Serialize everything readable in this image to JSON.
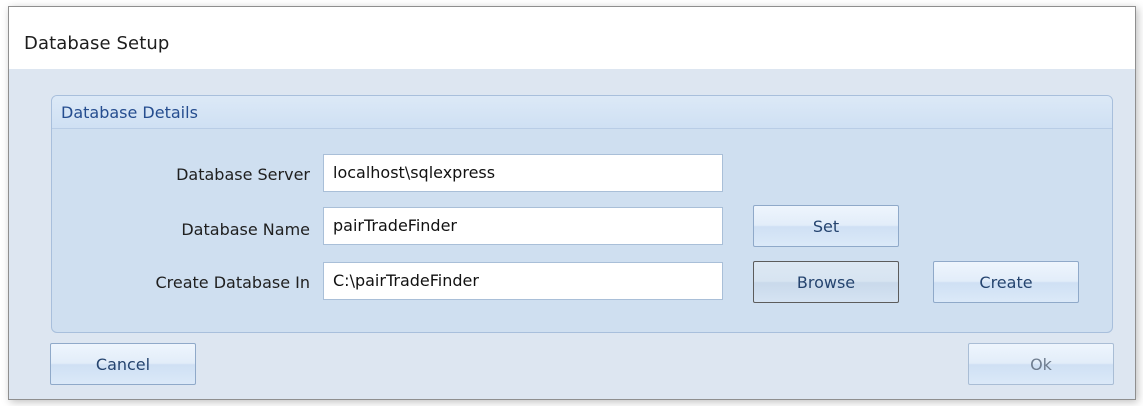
{
  "window": {
    "title": "Database Setup"
  },
  "group": {
    "title": "Database Details"
  },
  "fields": {
    "server": {
      "label": "Database Server",
      "value": "localhost\\sqlexpress"
    },
    "name": {
      "label": "Database Name",
      "value": "pairTradeFinder"
    },
    "location": {
      "label": "Create Database In",
      "value": "C:\\pairTradeFinder"
    }
  },
  "buttons": {
    "set": "Set",
    "browse": "Browse",
    "create": "Create",
    "cancel": "Cancel",
    "ok": "Ok"
  },
  "colors": {
    "background": "#dde6f1",
    "group_header_text": "#254d8f",
    "button_text": "#25446f"
  }
}
